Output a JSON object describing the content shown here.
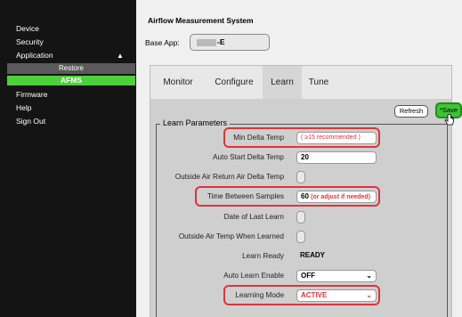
{
  "sidebar": {
    "items": [
      {
        "label": "Device"
      },
      {
        "label": "Security"
      },
      {
        "label": "Application"
      },
      {
        "label": "Restore"
      },
      {
        "label": "AFMS"
      },
      {
        "label": "Firmware"
      },
      {
        "label": "Help"
      },
      {
        "label": "Sign Out"
      }
    ],
    "expand_arrow": "▲"
  },
  "main": {
    "title": "Airflow Measurement System",
    "base_app_label": "Base App:",
    "base_app_suffix": "-E"
  },
  "tabs": [
    {
      "label": "Monitor"
    },
    {
      "label": "Configure"
    },
    {
      "label": "Learn"
    },
    {
      "label": "Tune"
    }
  ],
  "buttons": {
    "refresh": "Refresh",
    "save": "*Save"
  },
  "learn_params": {
    "legend": "Learn Parameters",
    "rows": [
      {
        "label": "Min Delta Temp",
        "value": "",
        "hint": "( ≥15 recommended )"
      },
      {
        "label": "Auto Start Delta Temp",
        "value": "20"
      },
      {
        "label": "Outside Air Return Air Delta Temp",
        "value": ""
      },
      {
        "label": "Time Between Samples",
        "value": "60",
        "hint": "(or adjust if needed)"
      },
      {
        "label": "Date of Last Learn",
        "value": ""
      },
      {
        "label": "Outside Air Temp When Learned",
        "value": ""
      },
      {
        "label": "Learn Ready",
        "value": "READY"
      },
      {
        "label": "Auto Learn Enable",
        "value": "OFF"
      },
      {
        "label": "Learning Mode",
        "value": "ACTIVE"
      }
    ]
  },
  "colors": {
    "accent": "#4cd03b",
    "highlight": "#e2323a",
    "sidebar": "#141414"
  }
}
